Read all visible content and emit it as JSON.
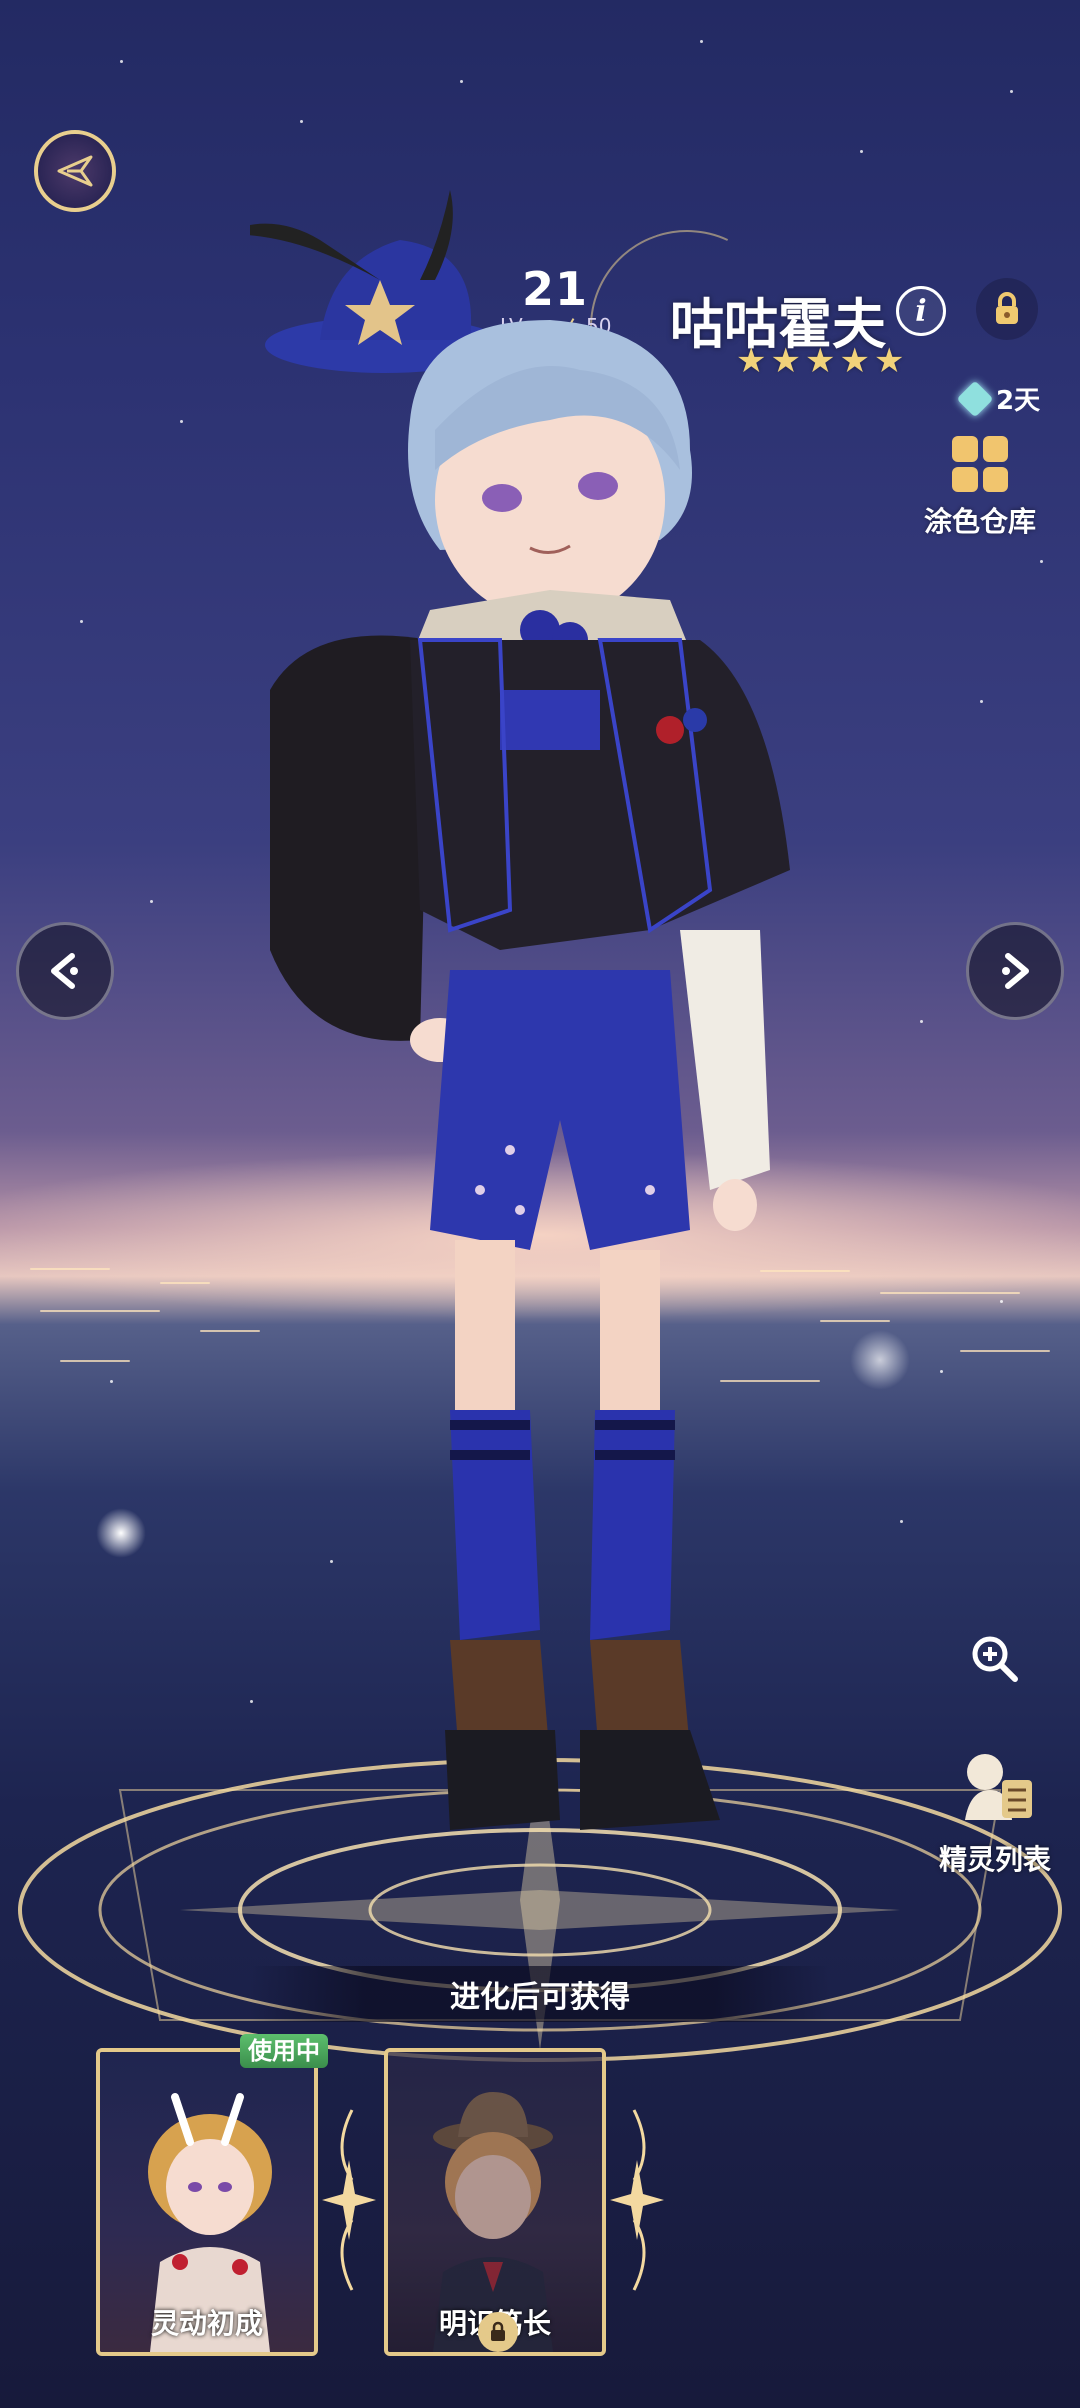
{
  "character": {
    "level": "21",
    "level_prefix": "LV",
    "level_max": "50",
    "name": "咕咕霍夫",
    "stars": [
      "★",
      "★",
      "★",
      "★",
      "★"
    ],
    "info_glyph": "i"
  },
  "sidebar": {
    "days_label": "2天",
    "paint_storage_label": "涂色仓库",
    "spirit_list_label": "精灵列表"
  },
  "evolution": {
    "banner_text": "进化后可获得",
    "in_use_label": "使用中",
    "cards": [
      {
        "label": "灵动初成",
        "locked": false
      },
      {
        "label": "明识笃长",
        "locked": true
      }
    ]
  },
  "icons": [
    "emblem-icon",
    "info-icon",
    "lock-icon",
    "diamond-icon",
    "paint-storage-icon",
    "prev-arrow-icon",
    "next-arrow-icon",
    "zoom-in-icon",
    "spirit-list-icon"
  ],
  "colors": {
    "gold": "#e9cf8e",
    "star": "#f1d27a",
    "accent": "#8fe0de",
    "in_use": "#4fa85e"
  }
}
